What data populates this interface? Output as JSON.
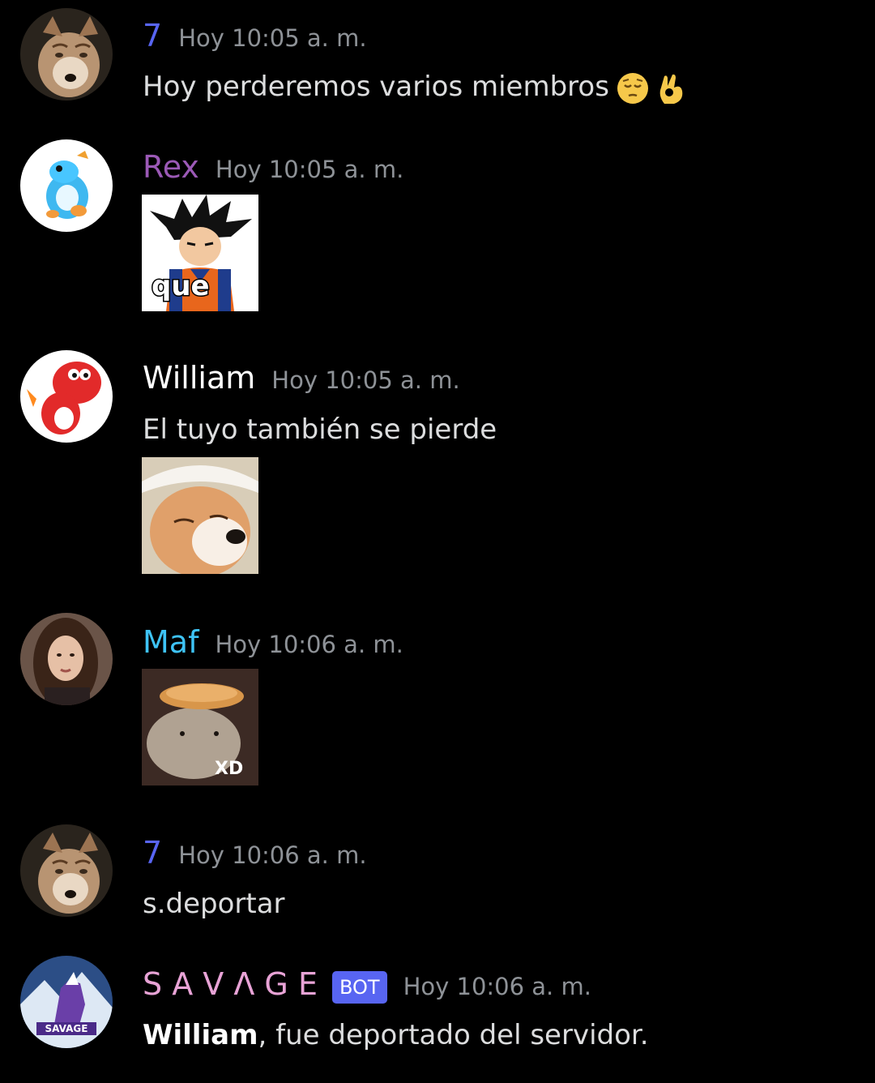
{
  "colors": {
    "background": "#000000",
    "timestamp": "#8e9297",
    "message_text": "#dcddde",
    "name_7": "#5865f2",
    "name_rex": "#9b59b6",
    "name_william": "#ffffff",
    "name_maf": "#3ec3f5",
    "name_savage": "#e8a3d6",
    "bot_badge": "#5865f2"
  },
  "messages": [
    {
      "author": "7",
      "timestamp": "Hoy 10:05 a. m.",
      "text": "Hoy perderemos varios miembros",
      "emojis": [
        "pensive-face-emoji",
        "ok-hand-emoji"
      ]
    },
    {
      "author": "Rex",
      "timestamp": "Hoy 10:05 a. m.",
      "image_caption": "que"
    },
    {
      "author": "William",
      "timestamp": "Hoy 10:05 a. m.",
      "text": "El tuyo también se pierde"
    },
    {
      "author": "Maf",
      "timestamp": "Hoy 10:06 a. m.",
      "image_caption": "XD"
    },
    {
      "author": "7",
      "timestamp": "Hoy 10:06 a. m.",
      "text": "s.deportar"
    },
    {
      "author": "S A V Λ G E",
      "badge": "BOT",
      "timestamp": "Hoy 10:06 a. m.",
      "text_bold": "William",
      "text": ", fue deportado del servidor.",
      "avatar_text": "SAVAGE"
    }
  ]
}
